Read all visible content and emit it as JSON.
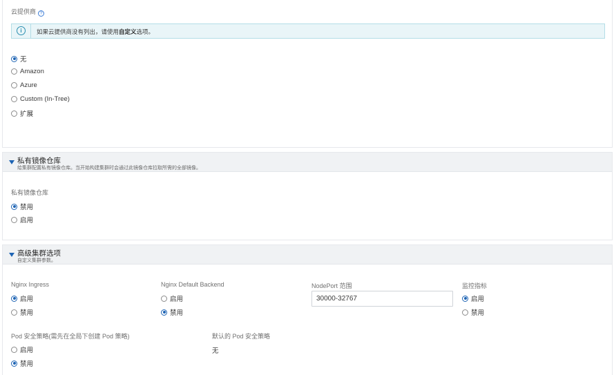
{
  "cloud": {
    "label": "云提供商",
    "help_icon": "?",
    "info_icon": "i",
    "info_text": "如果云提供商没有列出，请使用",
    "info_bold": "自定义",
    "info_suffix": "选项。",
    "options": [
      "无",
      "Amazon",
      "Azure",
      "Custom (In-Tree)",
      "扩展"
    ],
    "selected": "无"
  },
  "registry": {
    "title": "私有镜像仓库",
    "subtitle": "给集群配置私有镜像仓库。当开始构建集群时会通过此镜像仓库拉取所需的全部镜像。",
    "label": "私有镜像仓库",
    "options": [
      "禁用",
      "启用"
    ],
    "selected": "禁用"
  },
  "advanced": {
    "title": "高级集群选项",
    "subtitle": "自定义集群参数。",
    "nginx_ingress": {
      "label": "Nginx Ingress",
      "options": [
        "启用",
        "禁用"
      ],
      "selected": "启用"
    },
    "nginx_backend": {
      "label": "Nginx Default Backend",
      "options": [
        "启用",
        "禁用"
      ],
      "selected": "禁用"
    },
    "nodeport": {
      "label": "NodePort 范围",
      "value": "30000-32767"
    },
    "monitoring": {
      "label": "监控指标",
      "options": [
        "启用",
        "禁用"
      ],
      "selected": "启用"
    },
    "psp": {
      "label": "Pod 安全策略(需先在全局下创建 Pod 策略)",
      "options": [
        "启用",
        "禁用"
      ],
      "selected": "禁用"
    },
    "default_psp": {
      "label": "默认的 Pod 安全策略",
      "value": "无"
    }
  },
  "colors": {
    "accent": "#1e64b4",
    "info_bg": "#e9f5f8",
    "info_border": "#b3dde6",
    "header_bg": "#f0f2f4"
  }
}
